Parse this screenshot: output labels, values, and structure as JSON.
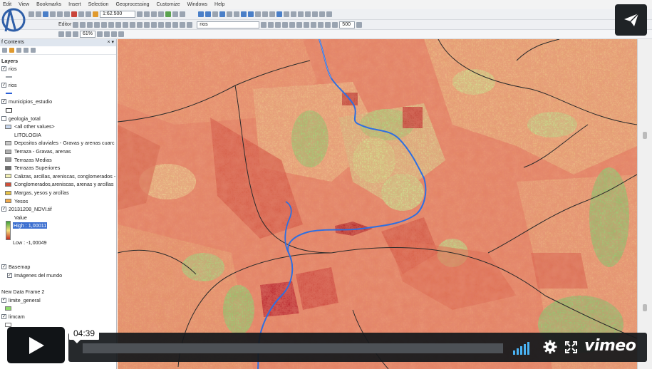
{
  "app": {
    "menu": [
      "Edit",
      "View",
      "Bookmarks",
      "Insert",
      "Selection",
      "Geoprocessing",
      "Customize",
      "Windows",
      "Help"
    ],
    "scale": "1:62.500",
    "editor_label": "Editor",
    "layer_dropdown": "rios",
    "zoom_value": "61%",
    "resolution_value": "500"
  },
  "toc": {
    "title": "f Contents",
    "layers_header": "Layers",
    "entries": [
      {
        "kind": "layer",
        "checked": true,
        "label": "rios"
      },
      {
        "kind": "line",
        "color": "#9aa0a6",
        "label": ""
      },
      {
        "kind": "layer",
        "checked": true,
        "label": "rios"
      },
      {
        "kind": "line",
        "color": "#2a5fd6",
        "label": ""
      },
      {
        "kind": "layer",
        "checked": true,
        "label": "municipios_estudio"
      },
      {
        "kind": "poly",
        "color": "#ffffff",
        "label": ""
      },
      {
        "kind": "layer",
        "checked": false,
        "label": "geologia_total"
      },
      {
        "kind": "sym",
        "color": "#c9d8ef",
        "label": "<all other values>"
      },
      {
        "kind": "text",
        "label": "LITOLOGIA"
      },
      {
        "kind": "sym",
        "color": "#c8c8c8",
        "label": "Depositos aluviales - Gravas y arenas cuarc"
      },
      {
        "kind": "sym",
        "color": "#b0b0b0",
        "label": "Terraza - Gravas, arenas"
      },
      {
        "kind": "sym",
        "color": "#9a9a9a",
        "label": "Terrazas Medias"
      },
      {
        "kind": "sym",
        "color": "#6f6f6f",
        "label": "Terrazas Superiores"
      },
      {
        "kind": "sym",
        "color": "#f2f0b5",
        "label": "Calizas, arcillas, areniscas, conglomerados -"
      },
      {
        "kind": "sym",
        "color": "#d0503a",
        "label": "Conglomerados,areniscas, arenas y arcillas"
      },
      {
        "kind": "sym",
        "color": "#e6c24a",
        "label": "Margas, yesos y arcillas"
      },
      {
        "kind": "sym",
        "color": "#f1a94b",
        "label": "Yesos"
      },
      {
        "kind": "layer",
        "checked": true,
        "label": "20131208_NDVI.tif"
      },
      {
        "kind": "text",
        "label": "Value"
      },
      {
        "kind": "ramp-high",
        "label": "High : 1,00011"
      },
      {
        "kind": "spacer",
        "label": ""
      },
      {
        "kind": "ramp-low",
        "label": "Low : -1,00049"
      },
      {
        "kind": "spacer",
        "label": ""
      },
      {
        "kind": "spacer",
        "label": ""
      },
      {
        "kind": "layer",
        "checked": true,
        "label": "Basemap"
      },
      {
        "kind": "sublayer",
        "checked": true,
        "label": "Imágenes del mundo"
      },
      {
        "kind": "spacer",
        "label": ""
      },
      {
        "kind": "plain",
        "label": "New Data Frame 2"
      },
      {
        "kind": "layer",
        "checked": true,
        "label": "limite_general"
      },
      {
        "kind": "sym",
        "color": "#8fdc6a",
        "label": ""
      },
      {
        "kind": "layer",
        "checked": true,
        "label": "limcam"
      },
      {
        "kind": "sym",
        "color": "#ffffff",
        "label": ""
      }
    ]
  },
  "player": {
    "time": "04:39",
    "brand": "vimeo",
    "share_icon": "paper-plane-icon",
    "play_icon": "play-icon",
    "volume_icon": "volume-bars-icon",
    "settings_icon": "gear-icon",
    "fullscreen_icon": "fullscreen-icon"
  },
  "colors": {
    "ndvi_low": "#c52a20",
    "ndvi_mid": "#f3e07a",
    "ndvi_high": "#3fa33b",
    "river": "#2f6fe0",
    "boundary": "#2b2b2b"
  }
}
